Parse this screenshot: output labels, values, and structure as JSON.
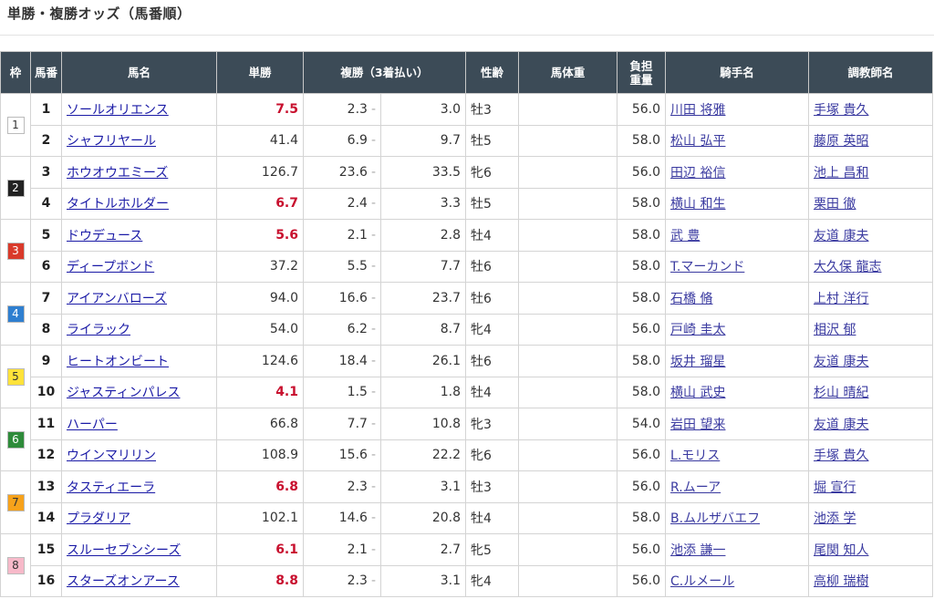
{
  "page": {
    "title": "単勝・複勝オッズ（馬番順）"
  },
  "columns": {
    "waku": "枠",
    "umaban": "馬番",
    "name": "馬名",
    "win": "単勝",
    "place": "複勝（3着払い）",
    "sex_age": "性齢",
    "body_weight": "馬体重",
    "carried_weight_l1": "負担",
    "carried_weight_l2": "重量",
    "jockey": "騎手名",
    "trainer": "調教師名"
  },
  "waku_colors": {
    "1": {
      "bg": "#ffffff",
      "fg": "#333333"
    },
    "2": {
      "bg": "#222222",
      "fg": "#ffffff"
    },
    "3": {
      "bg": "#d93a2b",
      "fg": "#ffffff"
    },
    "4": {
      "bg": "#2f7fd0",
      "fg": "#ffffff"
    },
    "5": {
      "bg": "#ffe23a",
      "fg": "#333333"
    },
    "6": {
      "bg": "#2e8b3a",
      "fg": "#ffffff"
    },
    "7": {
      "bg": "#f7a21b",
      "fg": "#333333"
    },
    "8": {
      "bg": "#f7b9c9",
      "fg": "#333333"
    }
  },
  "horses": [
    {
      "waku": "1",
      "num": "1",
      "name": "ソールオリエンス",
      "win": "7.5",
      "fav": true,
      "place_low": "2.3",
      "place_high": "3.0",
      "sex_age": "牡3",
      "body_weight": "",
      "weight": "56.0",
      "jockey": "川田 将雅",
      "trainer": "手塚 貴久"
    },
    {
      "waku": "",
      "num": "2",
      "name": "シャフリヤール",
      "win": "41.4",
      "fav": false,
      "place_low": "6.9",
      "place_high": "9.7",
      "sex_age": "牡5",
      "body_weight": "",
      "weight": "58.0",
      "jockey": "松山 弘平",
      "trainer": "藤原 英昭"
    },
    {
      "waku": "2",
      "num": "3",
      "name": "ホウオウエミーズ",
      "win": "126.7",
      "fav": false,
      "place_low": "23.6",
      "place_high": "33.5",
      "sex_age": "牝6",
      "body_weight": "",
      "weight": "56.0",
      "jockey": "田辺 裕信",
      "trainer": "池上 昌和"
    },
    {
      "waku": "",
      "num": "4",
      "name": "タイトルホルダー",
      "win": "6.7",
      "fav": true,
      "place_low": "2.4",
      "place_high": "3.3",
      "sex_age": "牡5",
      "body_weight": "",
      "weight": "58.0",
      "jockey": "横山 和生",
      "trainer": "栗田 徹"
    },
    {
      "waku": "3",
      "num": "5",
      "name": "ドウデュース",
      "win": "5.6",
      "fav": true,
      "place_low": "2.1",
      "place_high": "2.8",
      "sex_age": "牡4",
      "body_weight": "",
      "weight": "58.0",
      "jockey": "武 豊",
      "trainer": "友道 康夫"
    },
    {
      "waku": "",
      "num": "6",
      "name": "ディープボンド",
      "win": "37.2",
      "fav": false,
      "place_low": "5.5",
      "place_high": "7.7",
      "sex_age": "牡6",
      "body_weight": "",
      "weight": "58.0",
      "jockey": "T.マーカンド",
      "trainer": "大久保 龍志"
    },
    {
      "waku": "4",
      "num": "7",
      "name": "アイアンバローズ",
      "win": "94.0",
      "fav": false,
      "place_low": "16.6",
      "place_high": "23.7",
      "sex_age": "牡6",
      "body_weight": "",
      "weight": "58.0",
      "jockey": "石橋 脩",
      "trainer": "上村 洋行"
    },
    {
      "waku": "",
      "num": "8",
      "name": "ライラック",
      "win": "54.0",
      "fav": false,
      "place_low": "6.2",
      "place_high": "8.7",
      "sex_age": "牝4",
      "body_weight": "",
      "weight": "56.0",
      "jockey": "戸崎 圭太",
      "trainer": "相沢 郁"
    },
    {
      "waku": "5",
      "num": "9",
      "name": "ヒートオンビート",
      "win": "124.6",
      "fav": false,
      "place_low": "18.4",
      "place_high": "26.1",
      "sex_age": "牡6",
      "body_weight": "",
      "weight": "58.0",
      "jockey": "坂井 瑠星",
      "trainer": "友道 康夫"
    },
    {
      "waku": "",
      "num": "10",
      "name": "ジャスティンパレス",
      "win": "4.1",
      "fav": true,
      "place_low": "1.5",
      "place_high": "1.8",
      "sex_age": "牡4",
      "body_weight": "",
      "weight": "58.0",
      "jockey": "横山 武史",
      "trainer": "杉山 晴紀"
    },
    {
      "waku": "6",
      "num": "11",
      "name": "ハーパー",
      "win": "66.8",
      "fav": false,
      "place_low": "7.7",
      "place_high": "10.8",
      "sex_age": "牝3",
      "body_weight": "",
      "weight": "54.0",
      "jockey": "岩田 望来",
      "trainer": "友道 康夫"
    },
    {
      "waku": "",
      "num": "12",
      "name": "ウインマリリン",
      "win": "108.9",
      "fav": false,
      "place_low": "15.6",
      "place_high": "22.2",
      "sex_age": "牝6",
      "body_weight": "",
      "weight": "56.0",
      "jockey": "L.モリス",
      "trainer": "手塚 貴久"
    },
    {
      "waku": "7",
      "num": "13",
      "name": "タスティエーラ",
      "win": "6.8",
      "fav": true,
      "place_low": "2.3",
      "place_high": "3.1",
      "sex_age": "牡3",
      "body_weight": "",
      "weight": "56.0",
      "jockey": "R.ムーア",
      "trainer": "堀 宣行"
    },
    {
      "waku": "",
      "num": "14",
      "name": "プラダリア",
      "win": "102.1",
      "fav": false,
      "place_low": "14.6",
      "place_high": "20.8",
      "sex_age": "牡4",
      "body_weight": "",
      "weight": "58.0",
      "jockey": "B.ムルザバエフ",
      "trainer": "池添 学"
    },
    {
      "waku": "8",
      "num": "15",
      "name": "スルーセブンシーズ",
      "win": "6.1",
      "fav": true,
      "place_low": "2.1",
      "place_high": "2.7",
      "sex_age": "牝5",
      "body_weight": "",
      "weight": "56.0",
      "jockey": "池添 謙一",
      "trainer": "尾関 知人"
    },
    {
      "waku": "",
      "num": "16",
      "name": "スターズオンアース",
      "win": "8.8",
      "fav": true,
      "place_low": "2.3",
      "place_high": "3.1",
      "sex_age": "牝4",
      "body_weight": "",
      "weight": "56.0",
      "jockey": "C.ルメール",
      "trainer": "高柳 瑞樹"
    }
  ]
}
